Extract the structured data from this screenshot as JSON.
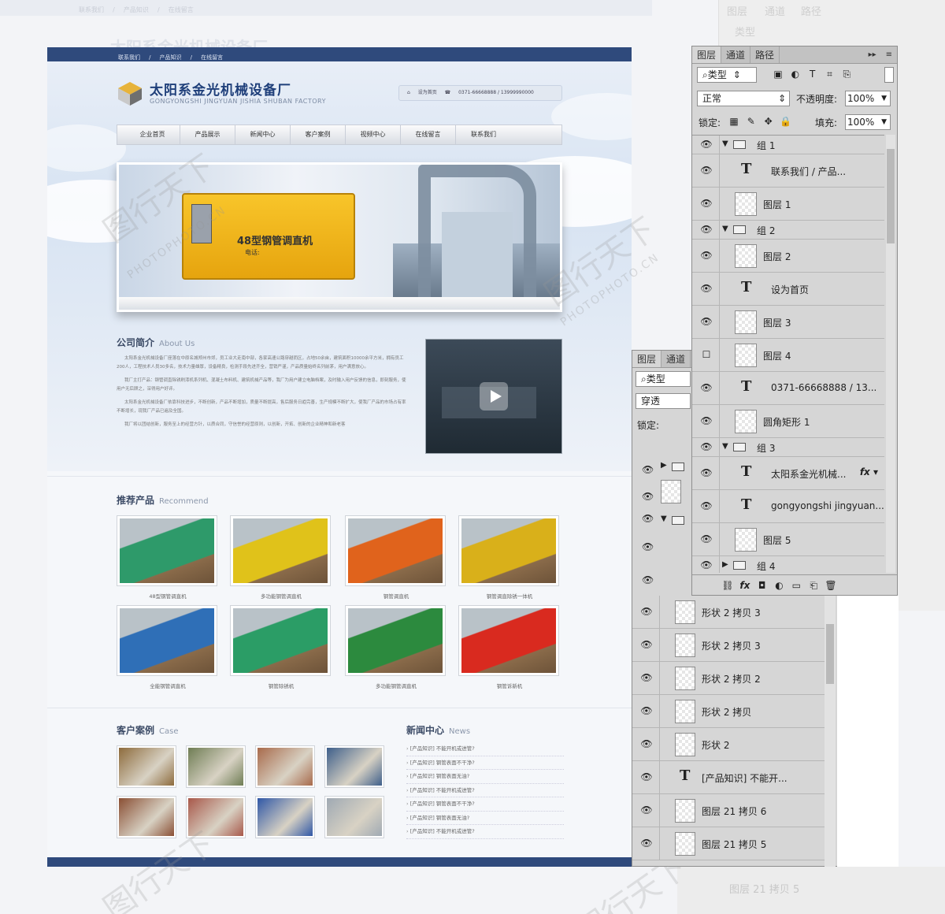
{
  "site": {
    "breadcrumb": [
      "联系我们",
      "/",
      "产品知识",
      "/",
      "在线留言"
    ],
    "title": "太阳系金光机械设备厂",
    "subtitle": "GONGYONGSHI JINGYUAN JISHIA SHUBAN FACTORY",
    "contact": {
      "home": "设为首页",
      "phone": "0371-66668888 / 13999990000"
    },
    "nav": [
      "企业首页",
      "产品展示",
      "新闻中心",
      "客户案例",
      "视频中心",
      "在线留言",
      "联系我们"
    ],
    "banner": {
      "label": "48型钢管调直机",
      "sublabel": "电话:"
    },
    "about": {
      "title": "公司简介",
      "title_en": "About Us",
      "paragraphs": [
        "太阳系金光机械设备厂座落在中原名城郑州市郊，员工业大走南中部，各家高速公路穿越而区，占地50余亩，建筑面积10000余平方米，拥有员工200人，工程技术人员30多名，技术力量雄厚，设备精良，检测手段先进齐全，营销严谨，产品质量始终名列前茅，用户满意放心。",
        "我厂主打产品：钢管调直除锈刷漆机系列机、混凝土布料机、建筑机械产品等，我厂为用户建立电脑档案，及时输入用户反馈的信息，即刻服务，使用户无后顾之，深得用户好评。",
        "太阳系金光机械设备厂依靠科技进步，不断创新，产品不断增加，质量不断提高，售后服务日趋完善，生产规模不断扩大，使我厂产品的市场占有率不断增长，现我厂产品已遍及全国。",
        "我厂将以团结创新，服务至上的经营方针，以质合同，守信誉的经营原则，以创新，开拓、创新的企业精神和新老客"
      ]
    },
    "recommend": {
      "title": "推荐产品",
      "title_en": "Recommend",
      "items": [
        {
          "caption": "48型钢管调直机",
          "color": "#2e9a6a"
        },
        {
          "caption": "多功能钢管调直机",
          "color": "#e0c21a"
        },
        {
          "caption": "钢管调直机",
          "color": "#e0631c"
        },
        {
          "caption": "钢管调直除锈一体机",
          "color": "#d9b01a"
        },
        {
          "caption": "全能钢管调直机",
          "color": "#2f6fb7"
        },
        {
          "caption": "钢管除锈机",
          "color": "#2b9d66"
        },
        {
          "caption": "多功能钢管调直机",
          "color": "#2c8a3e"
        },
        {
          "caption": "钢管诉新机",
          "color": "#d92a1f"
        }
      ]
    },
    "case": {
      "title": "客户案例",
      "title_en": "Case",
      "colors": [
        "#8d6b3c",
        "#6f7d54",
        "#a86a4b",
        "#3e5f8a",
        "#8a4f34",
        "#a8584a",
        "#2f57a6",
        "#9fa9b3"
      ]
    },
    "news": {
      "title": "新闻中心",
      "title_en": "News",
      "items": [
        "[产品知识] 不能开机或进管?",
        "[产品知识] 钢管表面不干净?",
        "[产品知识] 钢管表面无油?",
        "[产品知识] 不能开机或进管?",
        "[产品知识] 钢管表面不干净?",
        "[产品知识] 钢管表面无油?",
        "[产品知识] 不能开机或进管?"
      ]
    }
  },
  "watermark": {
    "cn": "图行天下",
    "en": "PHOTOPHOTO.CN"
  },
  "ps_main": {
    "tabs": [
      "图层",
      "通道",
      "路径"
    ],
    "filter_label": "类型",
    "blend_mode": "正常",
    "opacity_label": "不透明度:",
    "opacity": "100%",
    "lock_label": "锁定:",
    "fill_label": "填充:",
    "fill": "100%",
    "layers": [
      {
        "kind": "group",
        "name": "组 1"
      },
      {
        "kind": "text",
        "name": "联系我们  /  产品..."
      },
      {
        "kind": "pixel",
        "name": "图层 1"
      },
      {
        "kind": "group",
        "name": "组 2"
      },
      {
        "kind": "pixel",
        "name": "图层 2"
      },
      {
        "kind": "text",
        "name": "设为首页"
      },
      {
        "kind": "pixel",
        "name": "图层 3"
      },
      {
        "kind": "pixel",
        "name": "图层 4"
      },
      {
        "kind": "text",
        "name": "0371-66668888 / 13..."
      },
      {
        "kind": "shape",
        "name": "圆角矩形 1"
      },
      {
        "kind": "group",
        "name": "组 3"
      },
      {
        "kind": "text",
        "name": "太阳系金光机械..."
      },
      {
        "kind": "text",
        "name": "gongyongshi jingyuan..."
      },
      {
        "kind": "pixel",
        "name": "图层 5"
      },
      {
        "kind": "group",
        "name": "组 4"
      }
    ]
  },
  "ps_small": {
    "tabs": [
      "图层",
      "通道"
    ],
    "filter_label": "类型",
    "blend_mode": "穿透",
    "lock_label": "锁定:"
  },
  "ps_lower": {
    "layers": [
      {
        "kind": "shape",
        "name": "形状 2 拷贝 3"
      },
      {
        "kind": "shape",
        "name": "形状 2 拷贝 3"
      },
      {
        "kind": "shape",
        "name": "形状 2 拷贝 2"
      },
      {
        "kind": "shape",
        "name": "形状 2 拷贝"
      },
      {
        "kind": "shape",
        "name": "形状 2"
      },
      {
        "kind": "text",
        "name": "[产品知识] 不能开..."
      },
      {
        "kind": "pixel",
        "name": "图层 21 拷贝 6"
      },
      {
        "kind": "pixel",
        "name": "图层 21 拷贝 5"
      }
    ]
  },
  "background": {
    "tabs": [
      "图层",
      "通道",
      "路径"
    ],
    "filter": "类型",
    "bottom_layer": "图层 21 拷贝 5"
  }
}
